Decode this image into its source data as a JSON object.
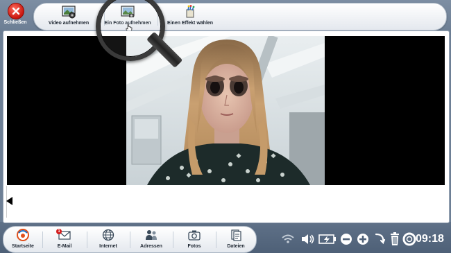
{
  "close": {
    "label": "Schließen"
  },
  "toolbar": {
    "items": [
      {
        "label": "Video aufnehmen",
        "icon": "video-record-icon"
      },
      {
        "label": "Ein Foto aufnehmen",
        "icon": "camera-photo-icon"
      },
      {
        "label": "Einen Effekt wählen",
        "icon": "magic-effect-icon"
      }
    ]
  },
  "nav": {
    "items": [
      {
        "label": "Startseite",
        "icon": "home-logo-icon"
      },
      {
        "label": "E-Mail",
        "icon": "envelope-icon",
        "badge": "1"
      },
      {
        "label": "Internet",
        "icon": "globe-icon"
      },
      {
        "label": "Adressen",
        "icon": "contacts-icon"
      },
      {
        "label": "Fotos",
        "icon": "camera-icon"
      },
      {
        "label": "Dateien",
        "icon": "files-icon"
      }
    ]
  },
  "tray": {
    "icons": [
      "wifi-icon",
      "volume-icon",
      "battery-charging-icon",
      "zoom-out-icon",
      "zoom-in-icon",
      "back-arrow-icon",
      "trash-icon",
      "help-lifebuoy-icon"
    ]
  },
  "clock": "09:18",
  "colors": {
    "accent": "#d31a1a",
    "background": "#6d7f95"
  }
}
